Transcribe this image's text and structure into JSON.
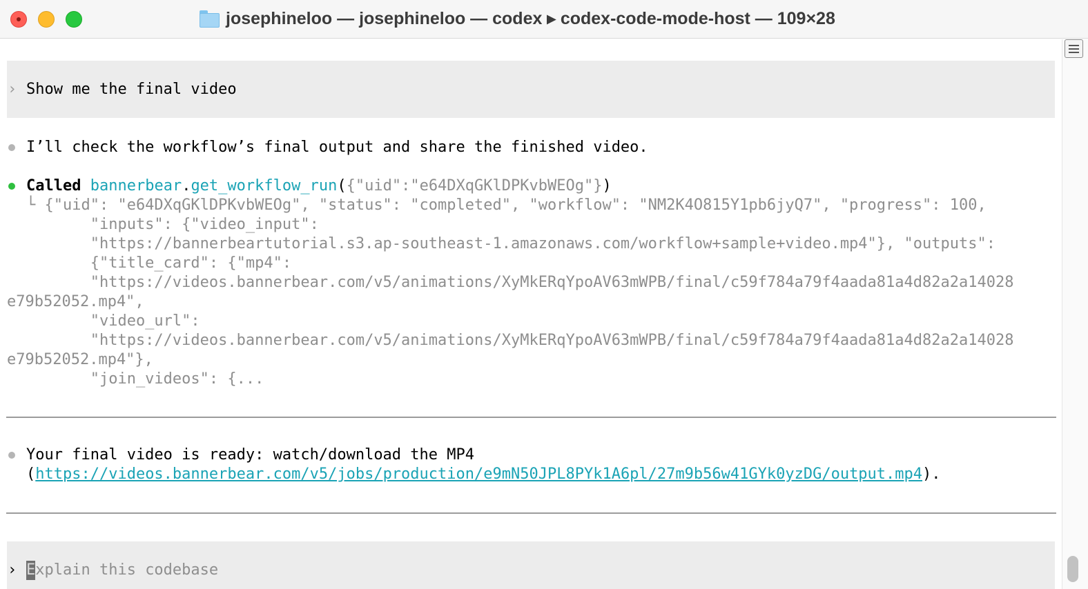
{
  "window": {
    "title": "josephineloo — josephineloo — codex ▸ codex-code-mode-host — 109×28",
    "icons": {
      "close": "close-icon",
      "minimize": "minimize-icon",
      "zoom": "zoom-icon",
      "folder": "folder-icon"
    }
  },
  "colors": {
    "accent": "#1aa3b5",
    "success_bullet": "#2fbf3f",
    "muted_text": "#8e8e8e",
    "prompt_bg": "#ececec"
  },
  "prompt_marker": "›",
  "conversation": {
    "user_prompt": "Show me the final video",
    "assistant_intro": "I’ll check the workflow’s final output and share the finished video.",
    "tool_call": {
      "status_label": "Called",
      "namespace": "bannerbear",
      "dot": ".",
      "method": "get_workflow_run",
      "open": "(",
      "args": "{\"uid\":\"e64DXqGKlDPKvbWEOg\"}",
      "close": ")",
      "result_lines": [
        "└ {\"uid\": \"e64DXqGKlDPKvbWEOg\", \"status\": \"completed\", \"workflow\": \"NM2K4O815Y1pb6jyQ7\", \"progress\": 100,",
        "       \"inputs\": {\"video_input\":",
        "       \"https://bannerbeartutorial.s3.ap-southeast-1.amazonaws.com/workflow+sample+video.mp4\"}, \"outputs\":",
        "       {\"title_card\": {\"mp4\":",
        "       \"https://videos.bannerbear.com/v5/animations/XyMkERqYpoAV63mWPB/final/c59f784a79f4aada81a4d82a2a14028",
        "e79b52052.mp4\",",
        "       \"video_url\":",
        "       \"https://videos.bannerbear.com/v5/animations/XyMkERqYpoAV63mWPB/final/c59f784a79f4aada81a4d82a2a14028",
        "e79b52052.mp4\"},",
        "       \"join_videos\": {..."
      ]
    },
    "final_message": {
      "line1": "Your final video is ready: watch/download the MP4",
      "open_paren": "(",
      "link": "https://videos.bannerbear.com/v5/jobs/production/e9mN50JPL8PYk1A6pl/27m9b56w41GYk0yzDG/output.mp4",
      "close_paren": ")."
    }
  },
  "composer": {
    "placeholder_first": "E",
    "placeholder_rest": "xplain this codebase"
  }
}
